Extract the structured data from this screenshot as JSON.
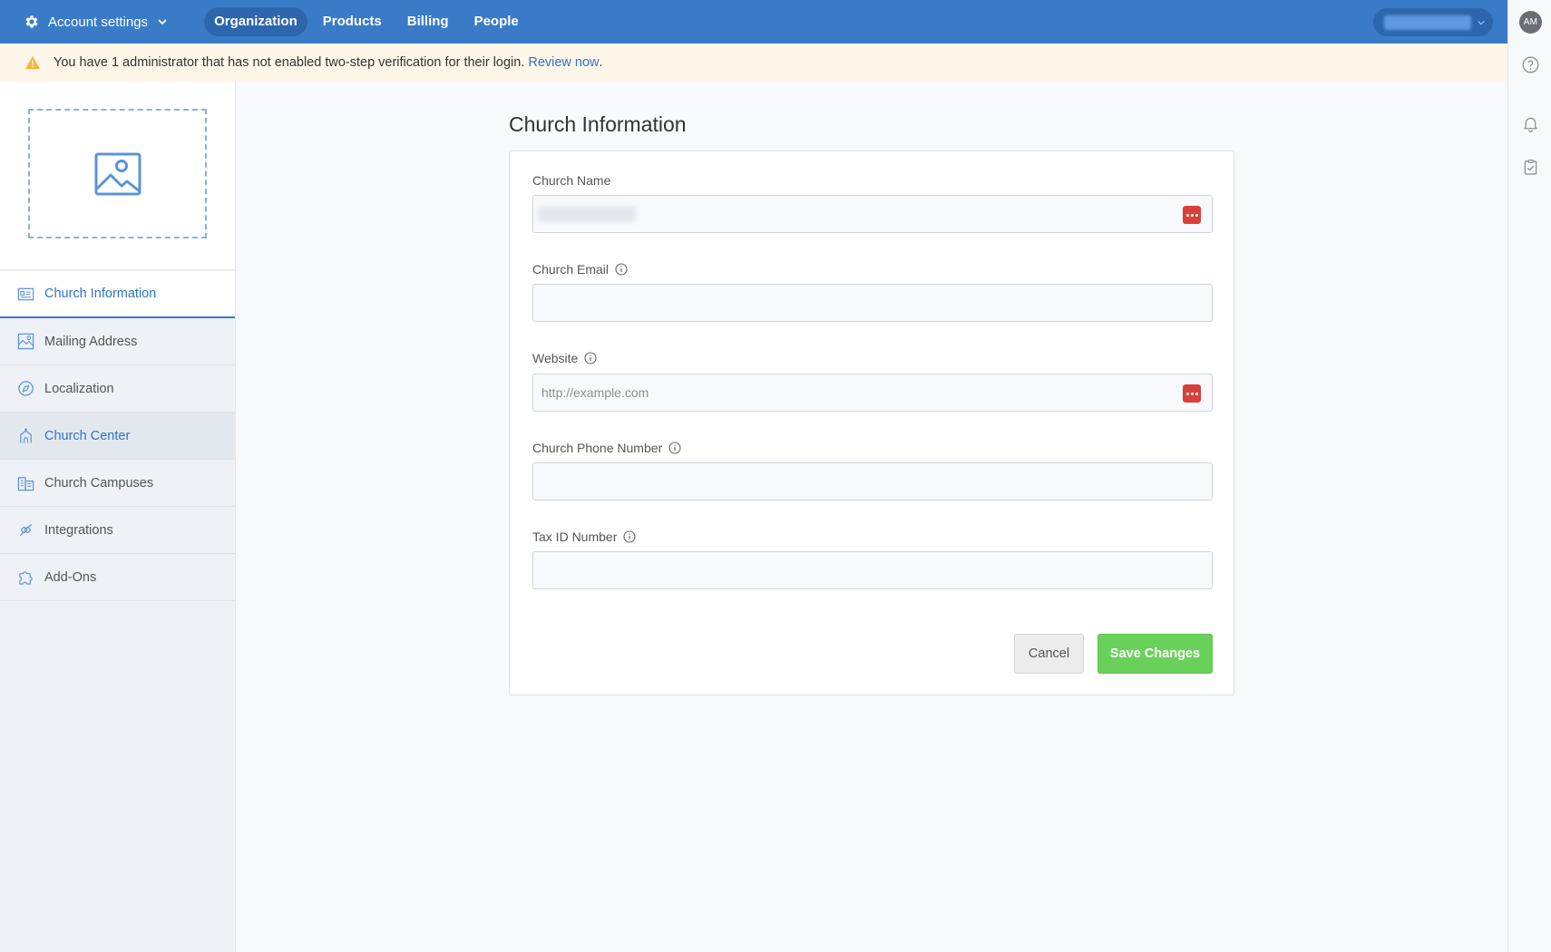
{
  "topbar": {
    "account_label": "Account settings",
    "nav": [
      {
        "label": "Organization",
        "active": true
      },
      {
        "label": "Products",
        "active": false
      },
      {
        "label": "Billing",
        "active": false
      },
      {
        "label": "People",
        "active": false
      }
    ],
    "accent_color": "#3a7bc8"
  },
  "rail": {
    "avatar_initials": "AM",
    "icons": [
      "help-icon",
      "bell-icon",
      "clipboard-check-icon"
    ]
  },
  "banner": {
    "message": "You have 1 administrator that has not enabled two-step verification for their login.",
    "link_text": "Review now",
    "trailing": "."
  },
  "sidebar": {
    "logo_placeholder_icon": "image-placeholder-icon",
    "items": [
      {
        "label": "Church Information",
        "icon": "id-card-icon",
        "state": "active"
      },
      {
        "label": "Mailing Address",
        "icon": "map-icon",
        "state": ""
      },
      {
        "label": "Localization",
        "icon": "compass-icon",
        "state": ""
      },
      {
        "label": "Church Center",
        "icon": "church-icon",
        "state": "hover"
      },
      {
        "label": "Church Campuses",
        "icon": "buildings-icon",
        "state": ""
      },
      {
        "label": "Integrations",
        "icon": "plug-icon",
        "state": ""
      },
      {
        "label": "Add-Ons",
        "icon": "puzzle-icon",
        "state": ""
      }
    ]
  },
  "main": {
    "title": "Church Information",
    "fields": [
      {
        "label": "Church Name",
        "has_info": false,
        "value": "",
        "placeholder": "",
        "password_manager_badge": true,
        "value_redacted": true
      },
      {
        "label": "Church Email",
        "has_info": true,
        "value": "",
        "placeholder": "",
        "password_manager_badge": false
      },
      {
        "label": "Website",
        "has_info": true,
        "value": "",
        "placeholder": "http://example.com",
        "password_manager_badge": true
      },
      {
        "label": "Church Phone Number",
        "has_info": true,
        "value": "",
        "placeholder": "",
        "password_manager_badge": false
      },
      {
        "label": "Tax ID Number",
        "has_info": true,
        "value": "",
        "placeholder": "",
        "password_manager_badge": false
      }
    ],
    "cancel_label": "Cancel",
    "save_label": "Save Changes",
    "save_color": "#69d15a"
  }
}
